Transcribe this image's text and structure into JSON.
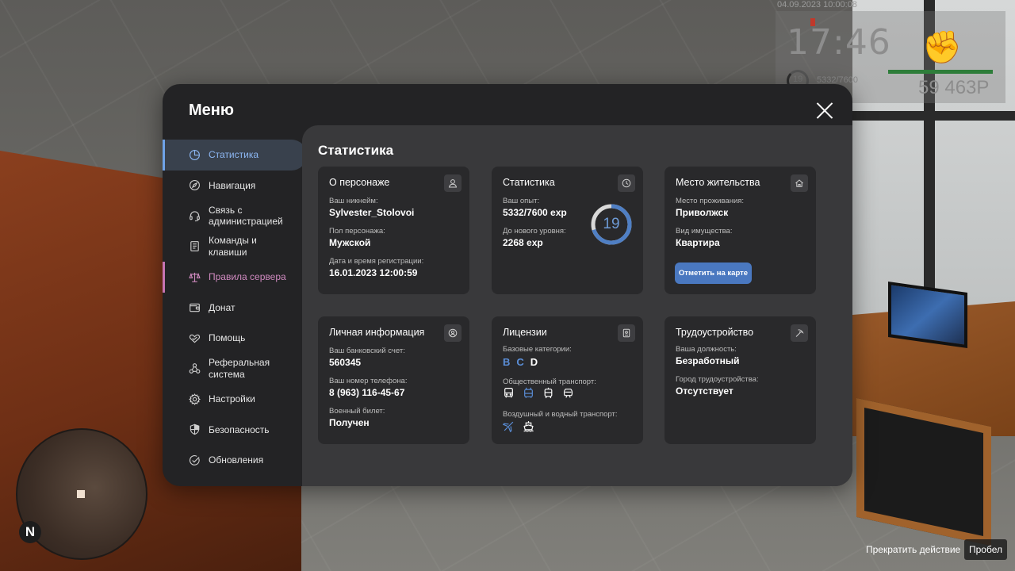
{
  "hud": {
    "datetime": "04.09.2023 10:00:08",
    "time": "17:46",
    "level": "19",
    "exp": "5332/7600",
    "money": "59 463P",
    "health_pct": 100
  },
  "minimap": {
    "north_label": "N"
  },
  "hint": {
    "text": "Прекратить действие",
    "key": "Пробел"
  },
  "menu": {
    "title": "Меню",
    "sidebar": [
      {
        "label": "Статистика",
        "icon": "pie-chart-icon",
        "state": "active"
      },
      {
        "label": "Навигация",
        "icon": "compass-icon",
        "state": ""
      },
      {
        "label": "Связь с администрацией",
        "icon": "headset-icon",
        "state": ""
      },
      {
        "label": "Команды и клавиши",
        "icon": "document-icon",
        "state": ""
      },
      {
        "label": "Правила сервера",
        "icon": "scales-icon",
        "state": "rules"
      },
      {
        "label": "Донат",
        "icon": "wallet-icon",
        "state": ""
      },
      {
        "label": "Помощь",
        "icon": "heart-hands-icon",
        "state": ""
      },
      {
        "label": "Реферальная система",
        "icon": "network-icon",
        "state": ""
      },
      {
        "label": "Настройки",
        "icon": "gear-icon",
        "state": ""
      },
      {
        "label": "Безопасность",
        "icon": "shield-icon",
        "state": ""
      },
      {
        "label": "Обновления",
        "icon": "check-circle-icon",
        "state": ""
      }
    ],
    "content_title": "Статистика",
    "character": {
      "title": "О персонаже",
      "nick_label": "Ваш никнейм:",
      "nick": "Sylvester_Stolovoi",
      "gender_label": "Пол персонажа:",
      "gender": "Мужской",
      "reg_label": "Дата и время регистрации:",
      "reg": "16.01.2023 12:00:59"
    },
    "stats": {
      "title": "Статистика",
      "exp_label": "Ваш опыт:",
      "exp": "5332/7600 exp",
      "next_label": "До нового уровня:",
      "next": "2268 exp",
      "level": "19",
      "progress": 0.7016
    },
    "residence": {
      "title": "Место жительства",
      "place_label": "Место проживания:",
      "place": "Приволжск",
      "type_label": "Вид имущества:",
      "type": "Квартира",
      "button": "Отметить на карте"
    },
    "personal": {
      "title": "Личная информация",
      "bank_label": "Ваш банковский счет:",
      "bank": "560345",
      "phone_label": "Ваш номер телефона:",
      "phone": "8 (963) 116-45-67",
      "military_label": "Военный билет:",
      "military": "Получен"
    },
    "licenses": {
      "title": "Лицензии",
      "base_label": "Базовые категории:",
      "categories": [
        {
          "letter": "B",
          "owned": true
        },
        {
          "letter": "C",
          "owned": true
        },
        {
          "letter": "D",
          "owned": false
        }
      ],
      "public_label": "Общественный транспорт:",
      "air_label": "Воздушный и водный транспорт:"
    },
    "employment": {
      "title": "Трудоустройство",
      "position_label": "Ваша должность:",
      "position": "Безработный",
      "city_label": "Город трудоустройства:",
      "city": "Отсутствует"
    }
  },
  "colors": {
    "accent": "#6fa3e8",
    "rules_accent": "#c774b3",
    "panel": "#232325",
    "content": "#39393b",
    "card": "#29292b",
    "button": "#4a78c0"
  }
}
